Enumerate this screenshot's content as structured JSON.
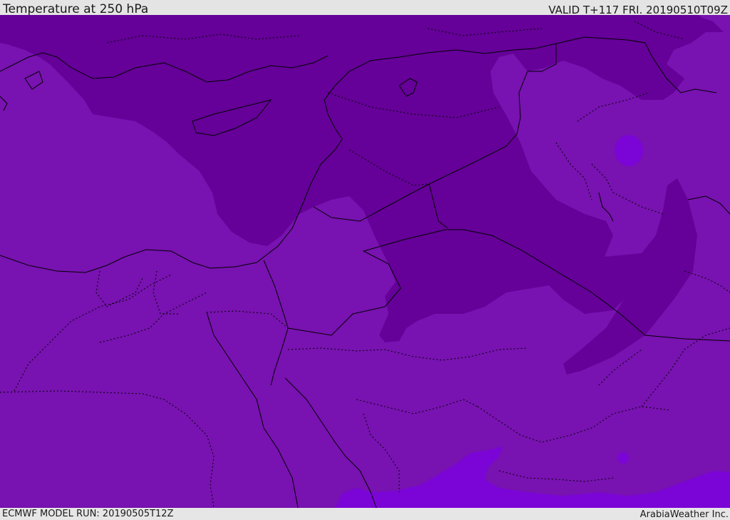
{
  "header": {
    "title": "Temperature at 250 hPa",
    "valid_time": "VALID T+117 FRI. 20190510T09Z"
  },
  "footer": {
    "model_run": "ECMWF MODEL RUN: 20190505T12Z",
    "credit": "ArabiaWeather Inc."
  },
  "map": {
    "field": "temperature-250hPa",
    "colors": {
      "background_shade": "#7812b0",
      "cold_shade": "#650098",
      "warm_shade": "#7b05d6",
      "boundary_line": "#000000"
    }
  }
}
